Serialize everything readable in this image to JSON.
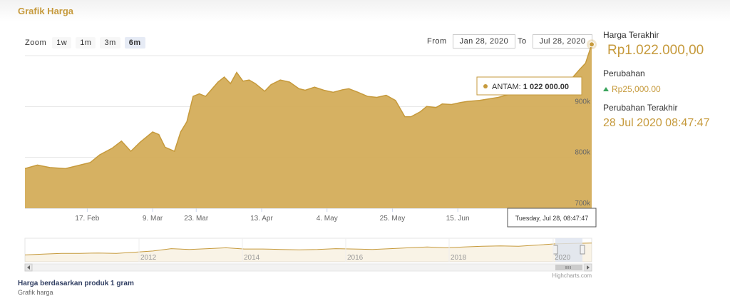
{
  "panel": {
    "title": "Grafik Harga"
  },
  "zoom": {
    "label": "Zoom",
    "buttons": [
      "1w",
      "1m",
      "3m",
      "6m"
    ],
    "active": "6m"
  },
  "range": {
    "from_label": "From",
    "from_value": "Jan 28, 2020",
    "to_label": "To",
    "to_value": "Jul 28, 2020"
  },
  "tooltip": {
    "series": "ANTAM:",
    "value": "1 022 000.00",
    "date": "Tuesday, Jul 28, 08:47:47"
  },
  "credits": "Highcharts.com",
  "side": {
    "last_price_label": "Harga Terakhir",
    "last_price": "Rp1.022.000,00",
    "change_label": "Perubahan",
    "change_value": "Rp25,000.00",
    "last_change_label": "Perubahan Terakhir",
    "last_change_time": "28 Jul 2020 08:47:47"
  },
  "footer": {
    "line1": "Harga berdasarkan produk 1 gram",
    "line2": "Grafik harga"
  },
  "colors": {
    "accent": "#c69a3c",
    "area": "#d4ad5a",
    "line": "#c69a3c",
    "up": "#3aa45c",
    "navigator_mask": "#dde4ef"
  },
  "chart_data": {
    "type": "area",
    "y_ticks": [
      "700k",
      "800k",
      "900k"
    ],
    "x_ticks": [
      "17. Feb",
      "9. Mar",
      "23. Mar",
      "13. Apr",
      "4. May",
      "25. May",
      "15. Jun"
    ],
    "ylim": [
      700000,
      1000000
    ],
    "xlim": [
      "2020-01-28",
      "2020-07-28"
    ],
    "x": [
      "2020-01-28",
      "2020-02-01",
      "2020-02-05",
      "2020-02-10",
      "2020-02-14",
      "2020-02-18",
      "2020-02-21",
      "2020-02-25",
      "2020-02-28",
      "2020-03-02",
      "2020-03-05",
      "2020-03-09",
      "2020-03-11",
      "2020-03-13",
      "2020-03-16",
      "2020-03-18",
      "2020-03-20",
      "2020-03-22",
      "2020-03-24",
      "2020-03-26",
      "2020-03-30",
      "2020-04-01",
      "2020-04-03",
      "2020-04-05",
      "2020-04-07",
      "2020-04-09",
      "2020-04-11",
      "2020-04-14",
      "2020-04-16",
      "2020-04-19",
      "2020-04-22",
      "2020-04-25",
      "2020-04-27",
      "2020-04-30",
      "2020-05-03",
      "2020-05-06",
      "2020-05-09",
      "2020-05-11",
      "2020-05-14",
      "2020-05-17",
      "2020-05-20",
      "2020-05-23",
      "2020-05-26",
      "2020-05-29",
      "2020-05-31",
      "2020-06-03",
      "2020-06-05",
      "2020-06-08",
      "2020-06-10",
      "2020-06-13",
      "2020-06-16",
      "2020-06-18",
      "2020-06-22",
      "2020-06-25",
      "2020-06-28",
      "2020-07-01",
      "2020-07-03",
      "2020-07-06",
      "2020-07-09",
      "2020-07-12",
      "2020-07-15",
      "2020-07-18",
      "2020-07-20",
      "2020-07-22",
      "2020-07-24",
      "2020-07-26",
      "2020-07-28"
    ],
    "values": [
      778000,
      785000,
      780000,
      778000,
      784000,
      790000,
      805000,
      818000,
      832000,
      812000,
      830000,
      850000,
      845000,
      820000,
      812000,
      850000,
      870000,
      920000,
      925000,
      920000,
      948000,
      958000,
      945000,
      967000,
      950000,
      952000,
      945000,
      930000,
      943000,
      952000,
      948000,
      935000,
      932000,
      938000,
      932000,
      928000,
      933000,
      935000,
      928000,
      920000,
      918000,
      922000,
      912000,
      880000,
      880000,
      890000,
      900000,
      898000,
      905000,
      904000,
      908000,
      910000,
      912000,
      915000,
      918000,
      923000,
      925000,
      928000,
      932000,
      932000,
      935000,
      940000,
      945000,
      958000,
      972000,
      985000,
      1022000
    ],
    "navigator": {
      "x_ticks": [
        "2012",
        "2014",
        "2016",
        "2018",
        "2020"
      ]
    }
  }
}
